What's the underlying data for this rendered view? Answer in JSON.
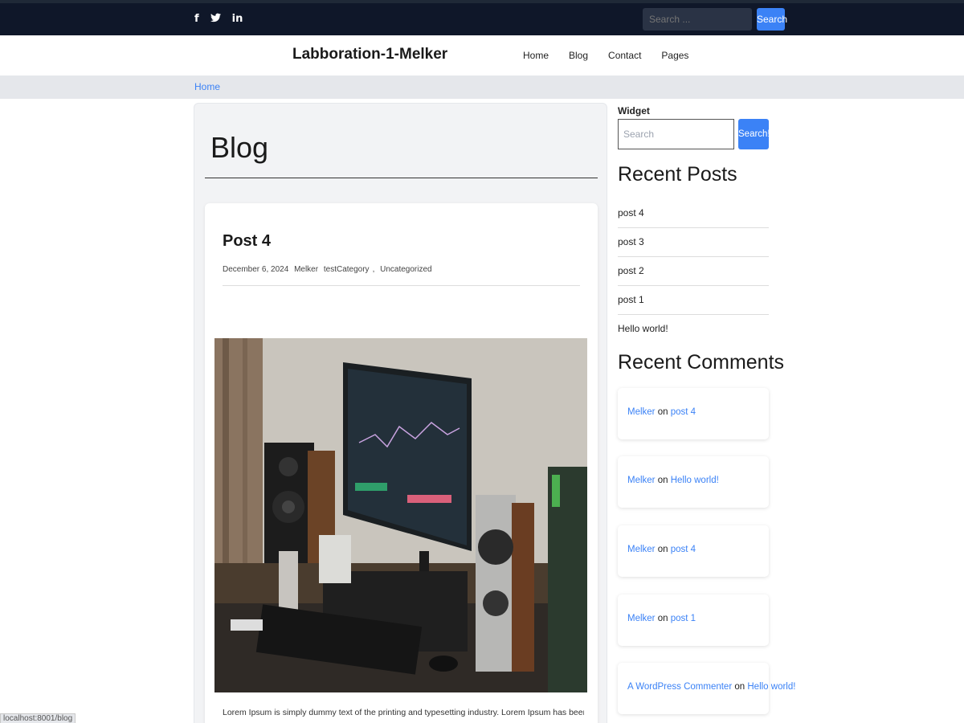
{
  "topbar": {
    "social": [
      {
        "icon": "facebook-icon",
        "glyph": "f"
      },
      {
        "icon": "twitter-icon",
        "glyph": "𝕥"
      },
      {
        "icon": "linkedin-icon",
        "glyph": "in"
      }
    ],
    "search_placeholder": "Search ...",
    "search_button": "Search"
  },
  "header": {
    "site_title": "Labboration-1-Melker",
    "nav": [
      "Home",
      "Blog",
      "Contact",
      "Pages"
    ]
  },
  "breadcrumb": {
    "home": "Home"
  },
  "main": {
    "page_title": "Blog",
    "post": {
      "title": "Post 4",
      "date": "December 6, 2024",
      "author": "Melker",
      "category1": "testCategory",
      "separator": ",",
      "category2": "Uncategorized",
      "excerpt": "Lorem Ipsum is simply dummy text of the printing and typesetting industry. Lorem Ipsum has been the industry's"
    }
  },
  "sidebar": {
    "widget_label": "Widget",
    "search_placeholder": "Search",
    "search_button": "Search!",
    "recent_posts_heading": "Recent Posts",
    "recent_posts": [
      "post 4",
      "post 3",
      "post 2",
      "post 1",
      "Hello world!"
    ],
    "recent_comments_heading": "Recent Comments",
    "on_word": "on",
    "comments": [
      {
        "author": "Melker",
        "post": "post 4"
      },
      {
        "author": "Melker",
        "post": "Hello world!"
      },
      {
        "author": "Melker",
        "post": "post 4"
      },
      {
        "author": "Melker",
        "post": "post 1"
      },
      {
        "author": "A WordPress Commenter",
        "post": "Hello world!"
      }
    ]
  },
  "statusbar": {
    "url": "localhost:8001/blog"
  },
  "colors": {
    "topbar_bg": "#0f1729",
    "accent": "#3b82f6",
    "breadcrumb_bg": "#e5e7eb",
    "main_bg": "#f2f3f5"
  }
}
